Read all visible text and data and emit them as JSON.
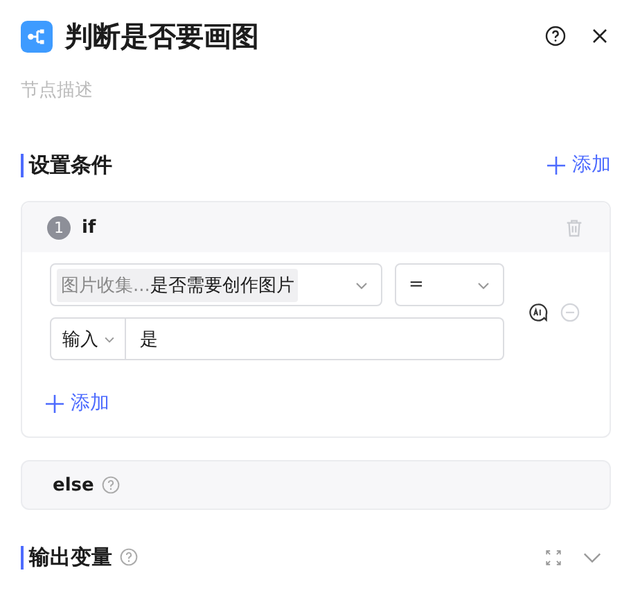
{
  "header": {
    "title": "判断是否要画图",
    "description_placeholder": "节点描述"
  },
  "conditions_section": {
    "title": "设置条件",
    "add_label": "添加"
  },
  "branches": [
    {
      "kind": "if",
      "index": "1",
      "label": "if",
      "rules": [
        {
          "variable_source": "图片收集...",
          "variable_name": "是否需要创作图片",
          "operator": "=",
          "value_type": "输入",
          "value": "是"
        }
      ],
      "add_label": "添加"
    },
    {
      "kind": "else",
      "label": "else"
    }
  ],
  "output_section": {
    "title": "输出变量",
    "expanded": false
  }
}
